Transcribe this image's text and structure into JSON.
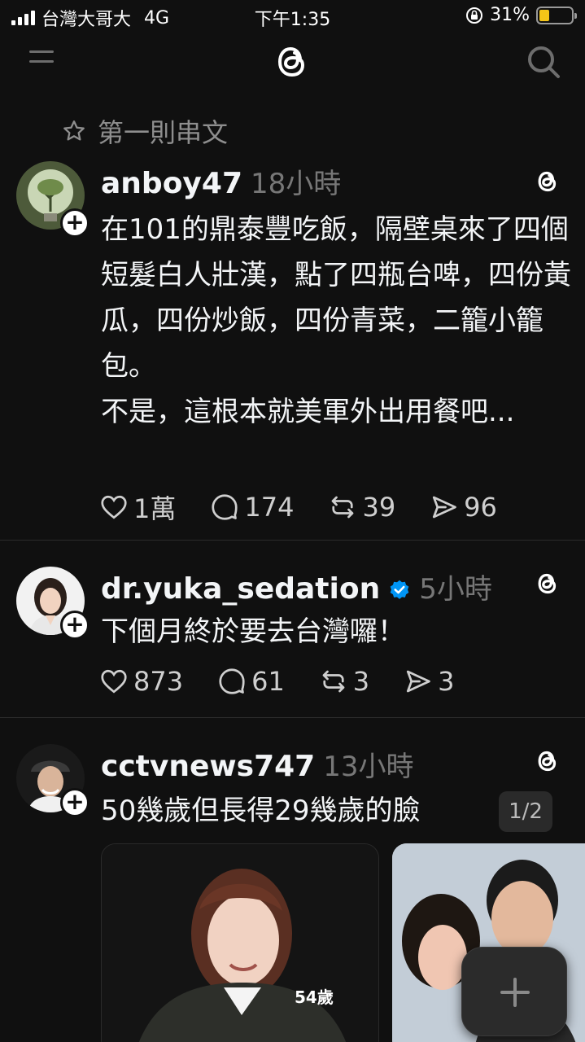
{
  "status_bar": {
    "carrier": "台灣大哥大",
    "network": "4G",
    "time": "下午1:35",
    "battery": "31%",
    "battery_level": 0.31
  },
  "nav": {
    "menu_icon": "menu-icon",
    "logo_icon": "threads-logo-icon",
    "search_icon": "search-icon"
  },
  "pinned_label": "第一則串文",
  "posts": [
    {
      "username": "anboy47",
      "time": "18小時",
      "paragraphs": [
        "在101的鼎泰豐吃飯，隔壁桌來了四個短髮白人壯漢，點了四瓶台啤，四份黃瓜，四份炒飯，四份青菜，二籠小籠包。",
        "不是，這根本就美軍外出用餐吧..."
      ],
      "likes": "1萬",
      "comments": "174",
      "reposts": "39",
      "shares": "96"
    },
    {
      "username": "dr.yuka_sedation",
      "verified": true,
      "time": "5小時",
      "paragraphs": [
        "下個月終於要去台灣囉！"
      ],
      "likes": "873",
      "comments": "61",
      "reposts": "3",
      "shares": "3"
    },
    {
      "username": "cctvnews747",
      "time": "13小時",
      "paragraphs": [
        "50幾歲但長得29幾歲的臉"
      ],
      "page_indicator": "1/2",
      "media_caption": "54歲"
    }
  ],
  "colors": {
    "background": "#101010",
    "text": "#f3f5f7",
    "muted": "#777777",
    "verified": "#0095f6",
    "battery": "#f5c518"
  }
}
